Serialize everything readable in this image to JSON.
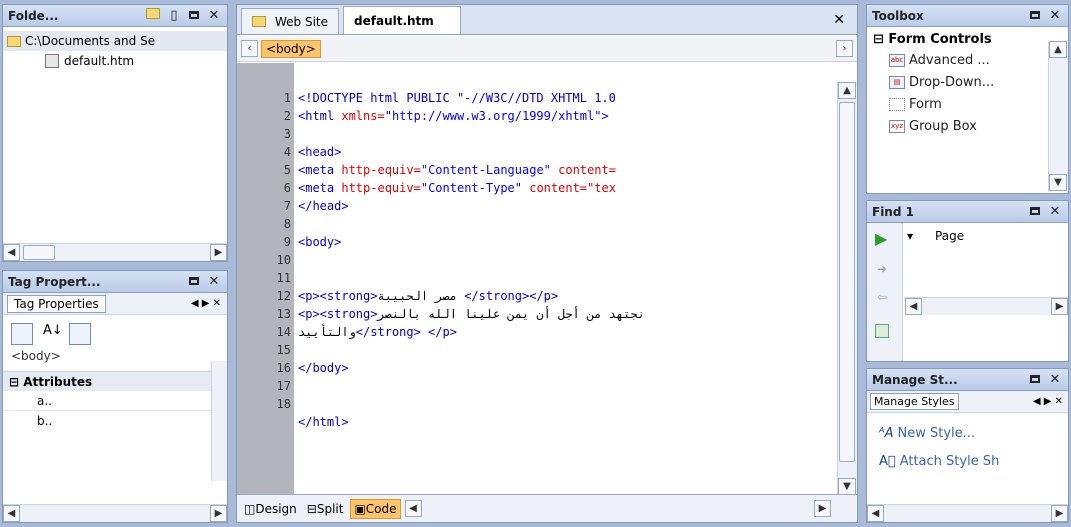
{
  "folder_pane": {
    "title": "Folde...",
    "items": [
      "C:\\Documents and Se",
      "default.htm"
    ]
  },
  "tag_pane": {
    "title": "Tag Propert...",
    "tab": "Tag Properties",
    "tag": "<body>",
    "section": "Attributes",
    "attrs": [
      "a..",
      "b.."
    ]
  },
  "editor": {
    "tabs": [
      "Web Site",
      "default.htm"
    ],
    "breadcrumb": "<body>",
    "views": [
      "Design",
      "Split",
      "Code"
    ],
    "lines": [
      "1",
      "2",
      "3",
      "4",
      "5",
      "6",
      "7",
      "8",
      "9",
      "10",
      "11",
      "12",
      "13",
      "14",
      "15",
      "16",
      "17",
      "18"
    ]
  },
  "toolbox": {
    "title": "Toolbox",
    "group": "Form Controls",
    "items": [
      "Advanced ...",
      "Drop-Down...",
      "Form",
      "Group Box"
    ]
  },
  "find": {
    "title": "Find 1",
    "col": "Page"
  },
  "styles": {
    "title": "Manage St...",
    "tab": "Manage Styles",
    "items": [
      "New Style...",
      "Attach Style Sh"
    ]
  },
  "code": {
    "l1": "<!DOCTYPE html PUBLIC \"-//W3C//DTD XHTML 1.0",
    "l2a": "<html ",
    "l2b": "xmlns=",
    "l2c": "\"http://www.w3.org/1999/xhtml\">",
    "l4": "<head>",
    "l5a": "<meta ",
    "l5b": "http-equiv=",
    "l5c": "\"Content-Language\" ",
    "l5d": "content=",
    "l6a": "<meta ",
    "l6b": "http-equiv=",
    "l6c": "\"Content-Type\" ",
    "l6d": "content=\"tex",
    "l7": "</head>",
    "l9": "<body>",
    "l11a": "<p><strong>",
    "l11b": "مصر الحبيبة ",
    "l11c": "</strong></p>",
    "l12a": "<p><strong>",
    "l12b": "نجتهد من أجل أن يمن علينا الله بالنصر",
    "l13a": "والتأييد",
    "l13b": "</strong> </p>",
    "l15": "</body>",
    "l17": "</html>"
  }
}
